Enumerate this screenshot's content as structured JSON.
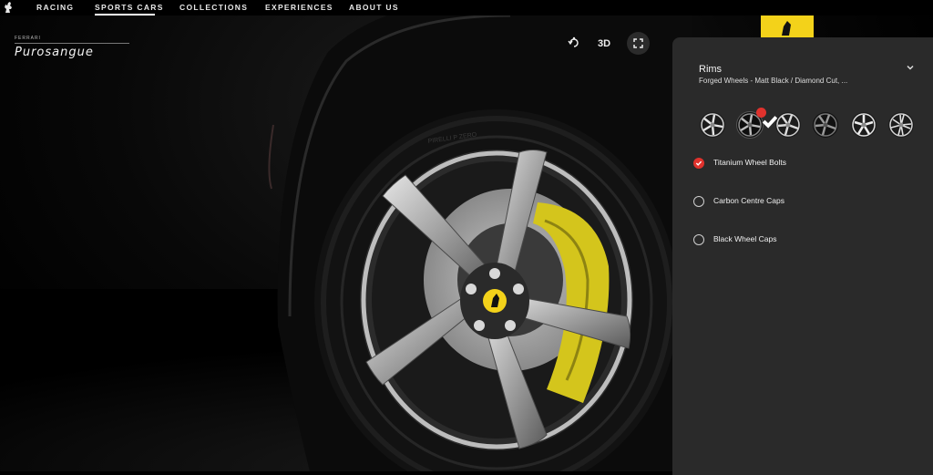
{
  "nav": {
    "items": [
      "RACING",
      "SPORTS CARS",
      "COLLECTIONS",
      "EXPERIENCES",
      "ABOUT US"
    ]
  },
  "brand": {
    "small": "FERRARI",
    "model": "Purosangue"
  },
  "controls": {
    "view_label": "3D"
  },
  "panel": {
    "section_title": "Rims",
    "selection": "Forged Wheels - Matt Black / Diamond Cut, ...",
    "wheel_options": [
      "5-spoke silver",
      "5-spoke matt black (selected)",
      "5-spoke diamond cut",
      "5-spoke dark grey",
      "5-spoke silver polished",
      "5-spoke silver twin"
    ],
    "selected_wheel_index": 1,
    "options": [
      {
        "label": "Titanium Wheel Bolts",
        "checked": true
      },
      {
        "label": "Carbon Centre Caps",
        "checked": false
      },
      {
        "label": "Black Wheel Caps",
        "checked": false
      }
    ]
  },
  "colors": {
    "accent": "#e0322d",
    "caliper": "#d4c51c",
    "panel_bg": "#2a2a2a",
    "badge_yellow": "#f3d21a"
  }
}
